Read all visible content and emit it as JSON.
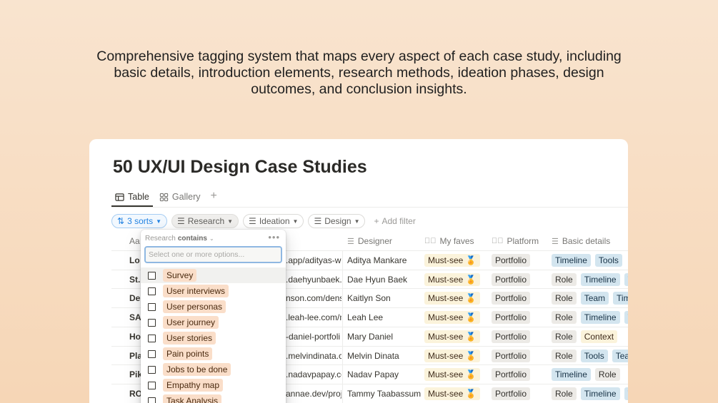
{
  "headline": "Comprehensive tagging system that maps every aspect of each case study, including basic details, introduction elements, research methods, ideation phases, design outcomes, and conclusion insights.",
  "doc_title": "50 UX/UI Design Case Studies",
  "views": [
    {
      "label": "Table",
      "icon": "table-icon",
      "active": true
    },
    {
      "label": "Gallery",
      "icon": "gallery-icon",
      "active": false
    }
  ],
  "add_view_symbol": "+",
  "filters": {
    "sorts": "3 sorts",
    "research": "Research",
    "ideation": "Ideation",
    "design": "Design",
    "add_filter": "Add filter"
  },
  "headers": {
    "name": "Aa",
    "designer": "Designer",
    "faves": "My faves",
    "platform": "Platform",
    "basic": "Basic details"
  },
  "rows": [
    {
      "name": "Lo",
      "url": ".app/adityas-wo",
      "designer": "Aditya Mankare",
      "fave": "Must-see 🏅",
      "platform": "Portfolio",
      "basic": [
        "Timeline",
        "Tools"
      ]
    },
    {
      "name": "St.",
      "url": ".daehyunbaek.c",
      "designer": "Dae Hyun Baek",
      "fave": "Must-see 🏅",
      "platform": "Portfolio",
      "basic": [
        "Role",
        "Timeline",
        "To"
      ]
    },
    {
      "name": "De",
      "url": "nson.com/dens",
      "designer": "Kaitlyn Son",
      "fave": "Must-see 🏅",
      "platform": "Portfolio",
      "basic": [
        "Role",
        "Team",
        "Time"
      ]
    },
    {
      "name": "SA",
      "url": ".leah-lee.com/m",
      "designer": "Leah Lee",
      "fave": "Must-see 🏅",
      "platform": "Portfolio",
      "basic": [
        "Role",
        "Timeline",
        "To"
      ]
    },
    {
      "name": "Ho",
      "url": "-daniel-portfoli",
      "designer": "Mary Daniel",
      "fave": "Must-see 🏅",
      "platform": "Portfolio",
      "basic": [
        "Role",
        "Context"
      ]
    },
    {
      "name": "Pla",
      "url": ".melvindinata.c",
      "designer": "Melvin Dinata",
      "fave": "Must-see 🏅",
      "platform": "Portfolio",
      "basic": [
        "Role",
        "Tools",
        "Team"
      ]
    },
    {
      "name": "Pik",
      "url": ".nadavpapay.co",
      "designer": "Nadav Papay",
      "fave": "Must-see 🏅",
      "platform": "Portfolio",
      "basic": [
        "Timeline",
        "Role"
      ]
    },
    {
      "name": "RO",
      "url": "annae.dev/proje",
      "designer": "Tammy Taabassum",
      "fave": "Must-see 🏅",
      "platform": "Portfolio",
      "basic": [
        "Role",
        "Timeline",
        "To"
      ]
    }
  ],
  "popover": {
    "prop": "Research",
    "op": "contains",
    "more": "•••",
    "placeholder": "Select one or more options...",
    "options": [
      "Survey",
      "User interviews",
      "User personas",
      "User journey",
      "User stories",
      "Pain points",
      "Jobs to be done",
      "Empathy map",
      "Task Analysis"
    ]
  },
  "colors": {
    "sorts_accent": "#2383e2",
    "tag_orange": "#fadec9",
    "tag_blue": "#d3e5ef",
    "tag_yellow": "#fbf3db",
    "tag_gray": "#eceae6"
  }
}
